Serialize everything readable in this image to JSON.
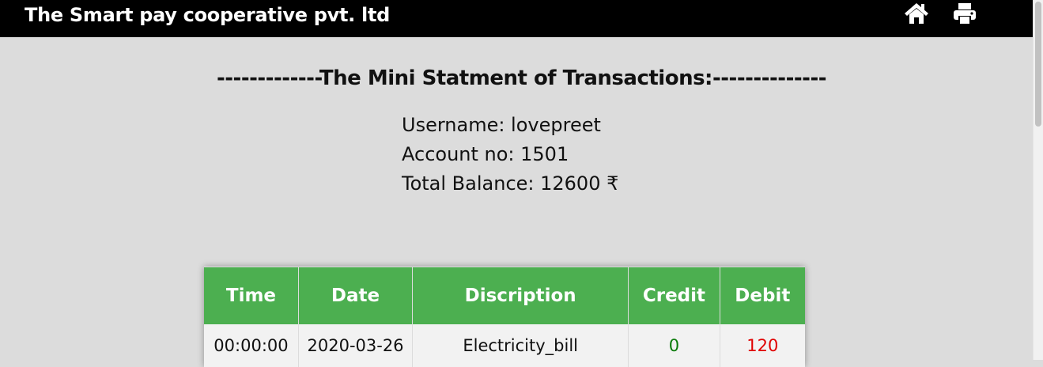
{
  "header": {
    "brand": "The Smart pay cooperative pvt. ltd",
    "home_icon": "home-icon",
    "print_icon": "print-icon"
  },
  "statement": {
    "title": "-------------The Mini Statment of Transactions:--------------",
    "username": "Username: lovepreet",
    "account": "Account no: 1501",
    "balance": "Total Balance: 12600 ₹"
  },
  "table": {
    "columns": [
      "Time",
      "Date",
      "Discription",
      "Credit",
      "Debit"
    ],
    "rows": [
      {
        "time": "00:00:00",
        "date": "2020-03-26",
        "description": "Electricity_bill",
        "credit": "0",
        "debit": "120"
      }
    ]
  },
  "colors": {
    "header_bg": "#000000",
    "page_bg": "#dcdcdc",
    "table_header_bg": "#4caf50",
    "credit": "#0a7a0a",
    "debit": "#e00000"
  }
}
